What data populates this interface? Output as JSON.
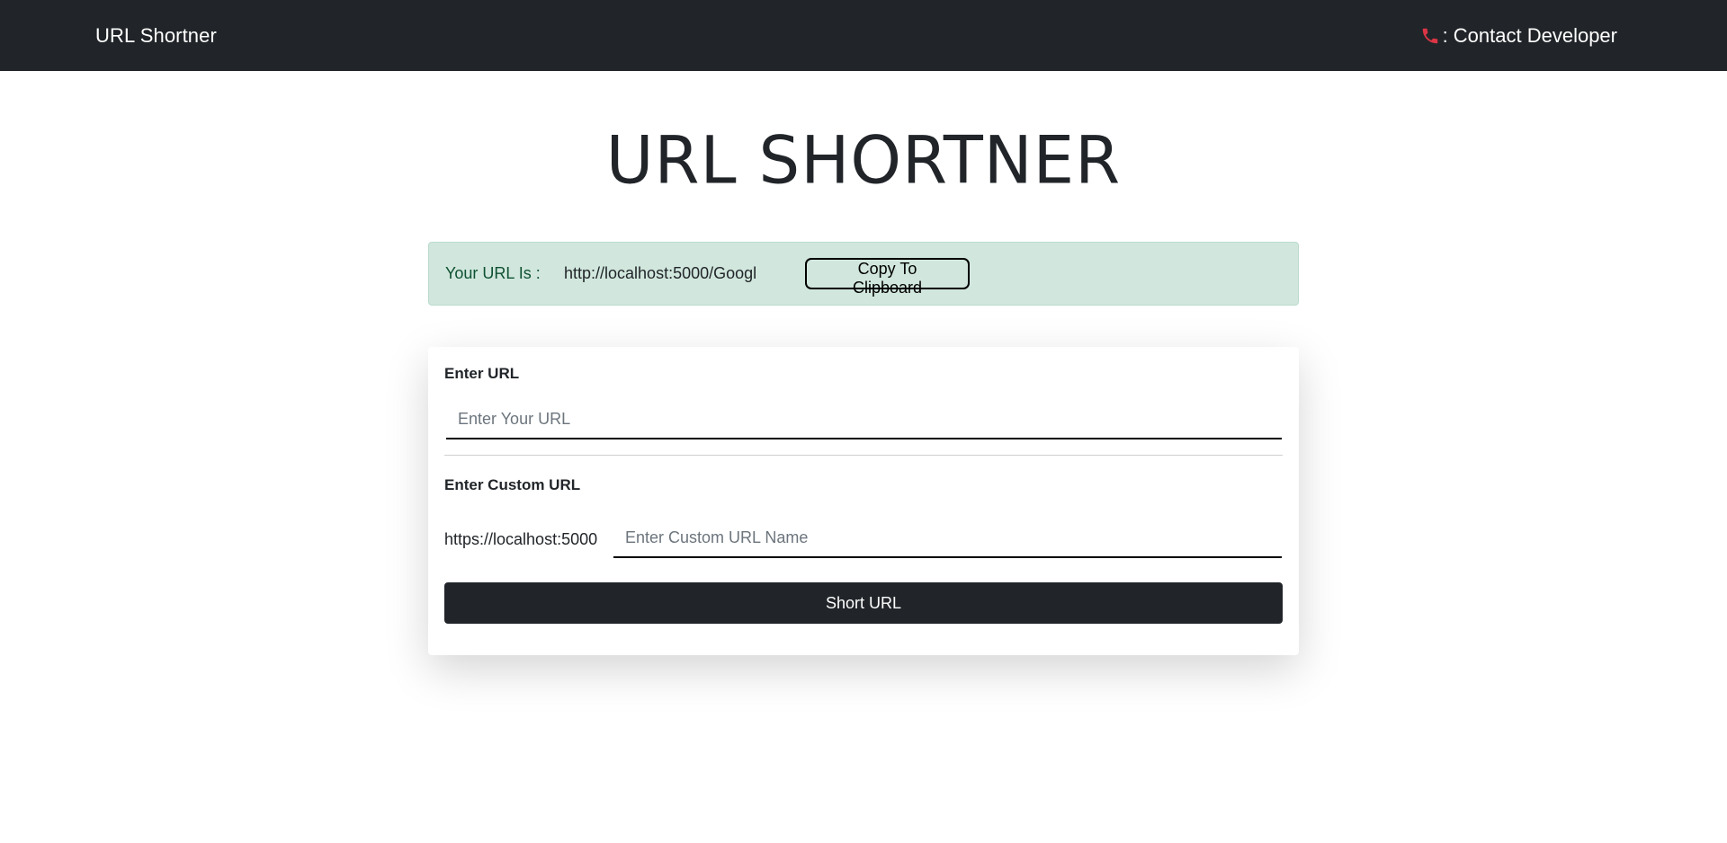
{
  "navbar": {
    "brand": "URL Shortner",
    "contact_label": ": Contact Developer",
    "contact_icon": "phone-icon"
  },
  "main": {
    "title": "URL SHORTNER"
  },
  "alert": {
    "label": "Your URL Is :",
    "short_url": "http://localhost:5000/Googl",
    "copy_label": "Copy To Clipboard"
  },
  "form": {
    "url_label": "Enter URL",
    "url_placeholder": "Enter Your URL",
    "url_value": "",
    "custom_label": "Enter Custom URL",
    "prefix": "https://localhost:5000",
    "custom_placeholder": "Enter Custom URL Name",
    "custom_value": "",
    "submit_label": "Short URL"
  },
  "colors": {
    "navbar_bg": "#212529",
    "alert_bg": "#d1e7dd",
    "alert_text": "#0f5132",
    "button_bg": "#212529",
    "phone_icon": "#dc3545"
  }
}
